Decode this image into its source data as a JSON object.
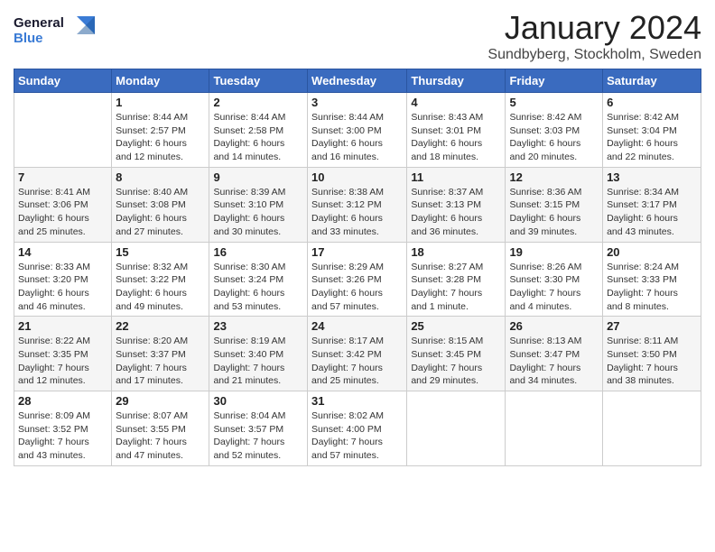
{
  "logo": {
    "line1": "General",
    "line2": "Blue"
  },
  "title": "January 2024",
  "subtitle": "Sundbyberg, Stockholm, Sweden",
  "days_header": [
    "Sunday",
    "Monday",
    "Tuesday",
    "Wednesday",
    "Thursday",
    "Friday",
    "Saturday"
  ],
  "weeks": [
    [
      {
        "day": "",
        "info": ""
      },
      {
        "day": "1",
        "info": "Sunrise: 8:44 AM\nSunset: 2:57 PM\nDaylight: 6 hours\nand 12 minutes."
      },
      {
        "day": "2",
        "info": "Sunrise: 8:44 AM\nSunset: 2:58 PM\nDaylight: 6 hours\nand 14 minutes."
      },
      {
        "day": "3",
        "info": "Sunrise: 8:44 AM\nSunset: 3:00 PM\nDaylight: 6 hours\nand 16 minutes."
      },
      {
        "day": "4",
        "info": "Sunrise: 8:43 AM\nSunset: 3:01 PM\nDaylight: 6 hours\nand 18 minutes."
      },
      {
        "day": "5",
        "info": "Sunrise: 8:42 AM\nSunset: 3:03 PM\nDaylight: 6 hours\nand 20 minutes."
      },
      {
        "day": "6",
        "info": "Sunrise: 8:42 AM\nSunset: 3:04 PM\nDaylight: 6 hours\nand 22 minutes."
      }
    ],
    [
      {
        "day": "7",
        "info": "Sunrise: 8:41 AM\nSunset: 3:06 PM\nDaylight: 6 hours\nand 25 minutes."
      },
      {
        "day": "8",
        "info": "Sunrise: 8:40 AM\nSunset: 3:08 PM\nDaylight: 6 hours\nand 27 minutes."
      },
      {
        "day": "9",
        "info": "Sunrise: 8:39 AM\nSunset: 3:10 PM\nDaylight: 6 hours\nand 30 minutes."
      },
      {
        "day": "10",
        "info": "Sunrise: 8:38 AM\nSunset: 3:12 PM\nDaylight: 6 hours\nand 33 minutes."
      },
      {
        "day": "11",
        "info": "Sunrise: 8:37 AM\nSunset: 3:13 PM\nDaylight: 6 hours\nand 36 minutes."
      },
      {
        "day": "12",
        "info": "Sunrise: 8:36 AM\nSunset: 3:15 PM\nDaylight: 6 hours\nand 39 minutes."
      },
      {
        "day": "13",
        "info": "Sunrise: 8:34 AM\nSunset: 3:17 PM\nDaylight: 6 hours\nand 43 minutes."
      }
    ],
    [
      {
        "day": "14",
        "info": "Sunrise: 8:33 AM\nSunset: 3:20 PM\nDaylight: 6 hours\nand 46 minutes."
      },
      {
        "day": "15",
        "info": "Sunrise: 8:32 AM\nSunset: 3:22 PM\nDaylight: 6 hours\nand 49 minutes."
      },
      {
        "day": "16",
        "info": "Sunrise: 8:30 AM\nSunset: 3:24 PM\nDaylight: 6 hours\nand 53 minutes."
      },
      {
        "day": "17",
        "info": "Sunrise: 8:29 AM\nSunset: 3:26 PM\nDaylight: 6 hours\nand 57 minutes."
      },
      {
        "day": "18",
        "info": "Sunrise: 8:27 AM\nSunset: 3:28 PM\nDaylight: 7 hours\nand 1 minute."
      },
      {
        "day": "19",
        "info": "Sunrise: 8:26 AM\nSunset: 3:30 PM\nDaylight: 7 hours\nand 4 minutes."
      },
      {
        "day": "20",
        "info": "Sunrise: 8:24 AM\nSunset: 3:33 PM\nDaylight: 7 hours\nand 8 minutes."
      }
    ],
    [
      {
        "day": "21",
        "info": "Sunrise: 8:22 AM\nSunset: 3:35 PM\nDaylight: 7 hours\nand 12 minutes."
      },
      {
        "day": "22",
        "info": "Sunrise: 8:20 AM\nSunset: 3:37 PM\nDaylight: 7 hours\nand 17 minutes."
      },
      {
        "day": "23",
        "info": "Sunrise: 8:19 AM\nSunset: 3:40 PM\nDaylight: 7 hours\nand 21 minutes."
      },
      {
        "day": "24",
        "info": "Sunrise: 8:17 AM\nSunset: 3:42 PM\nDaylight: 7 hours\nand 25 minutes."
      },
      {
        "day": "25",
        "info": "Sunrise: 8:15 AM\nSunset: 3:45 PM\nDaylight: 7 hours\nand 29 minutes."
      },
      {
        "day": "26",
        "info": "Sunrise: 8:13 AM\nSunset: 3:47 PM\nDaylight: 7 hours\nand 34 minutes."
      },
      {
        "day": "27",
        "info": "Sunrise: 8:11 AM\nSunset: 3:50 PM\nDaylight: 7 hours\nand 38 minutes."
      }
    ],
    [
      {
        "day": "28",
        "info": "Sunrise: 8:09 AM\nSunset: 3:52 PM\nDaylight: 7 hours\nand 43 minutes."
      },
      {
        "day": "29",
        "info": "Sunrise: 8:07 AM\nSunset: 3:55 PM\nDaylight: 7 hours\nand 47 minutes."
      },
      {
        "day": "30",
        "info": "Sunrise: 8:04 AM\nSunset: 3:57 PM\nDaylight: 7 hours\nand 52 minutes."
      },
      {
        "day": "31",
        "info": "Sunrise: 8:02 AM\nSunset: 4:00 PM\nDaylight: 7 hours\nand 57 minutes."
      },
      {
        "day": "",
        "info": ""
      },
      {
        "day": "",
        "info": ""
      },
      {
        "day": "",
        "info": ""
      }
    ]
  ]
}
